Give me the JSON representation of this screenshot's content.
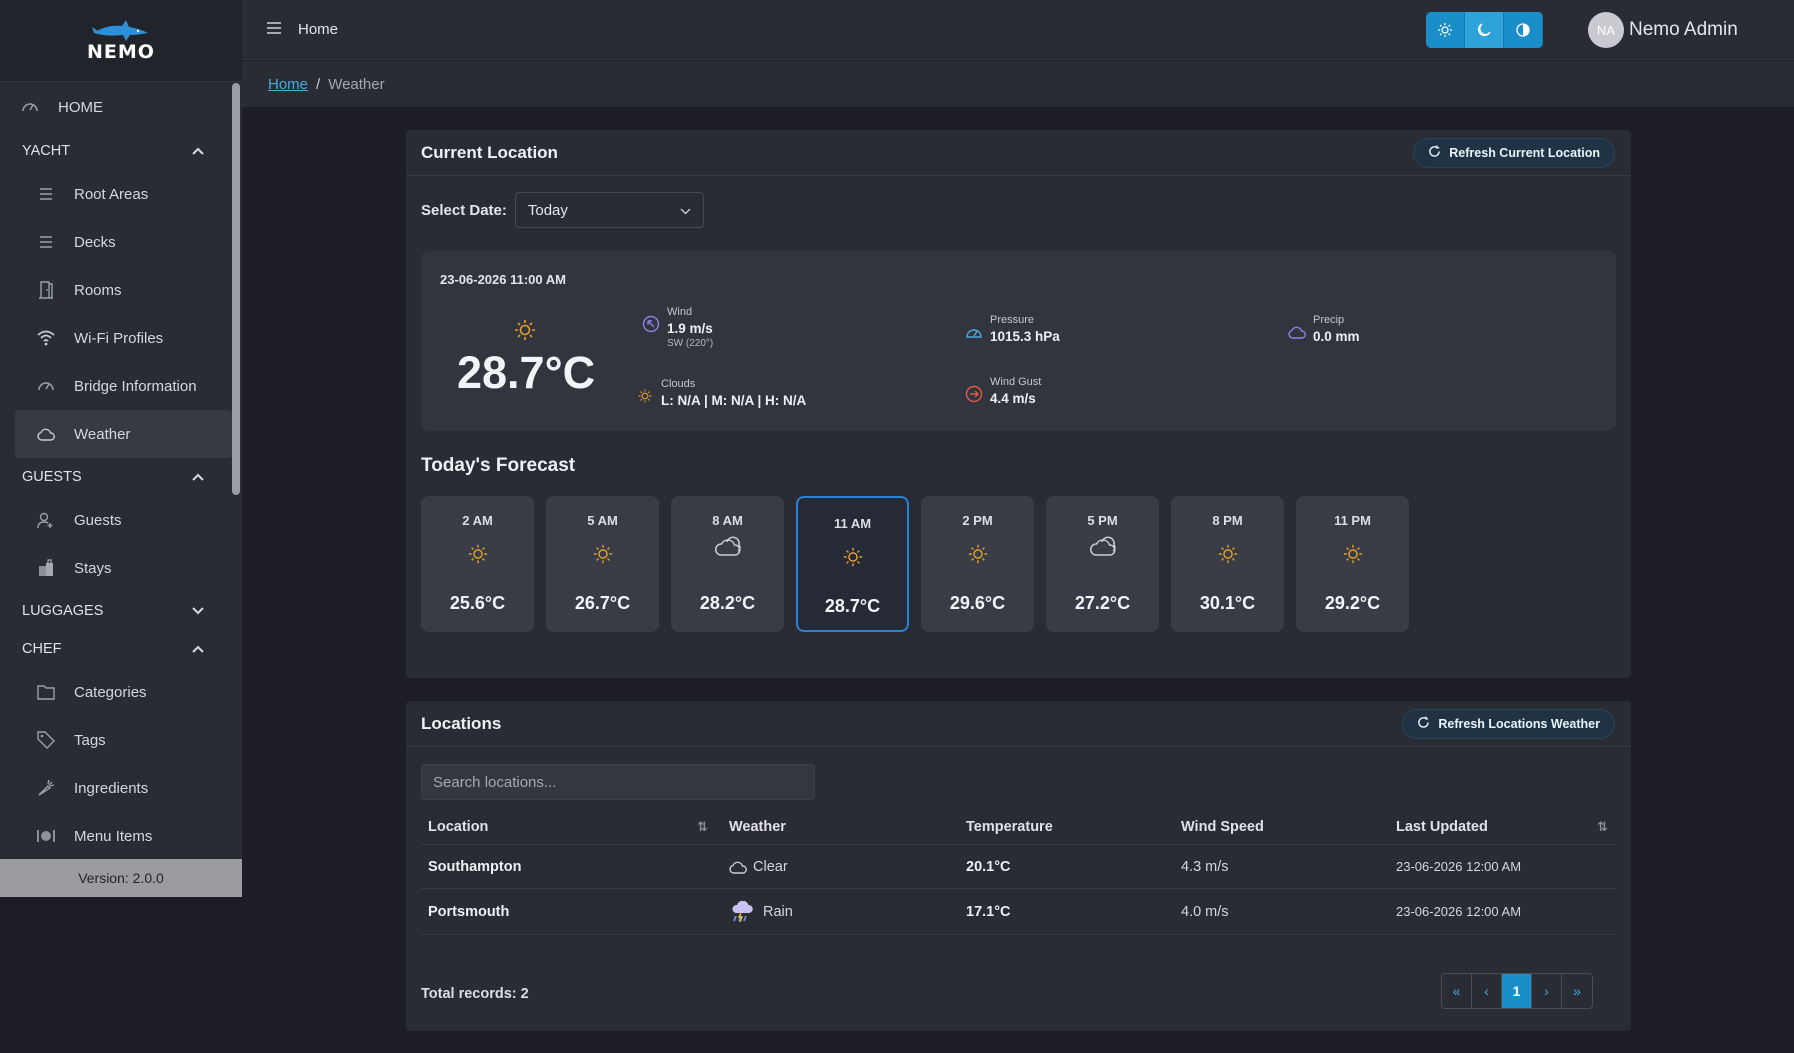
{
  "app": {
    "logo_text": "NEMO"
  },
  "topbar": {
    "page_title": "Home",
    "user_initials": "NA",
    "user_name": "Nemo Admin"
  },
  "breadcrumb": {
    "home": "Home",
    "separator": "/",
    "current": "Weather"
  },
  "sidebar": {
    "home": "HOME",
    "sections": {
      "yacht": "YACHT",
      "guests": "GUESTS",
      "luggages": "LUGGAGES",
      "chef": "CHEF"
    },
    "items": {
      "root_areas": "Root Areas",
      "decks": "Decks",
      "rooms": "Rooms",
      "wifi": "Wi-Fi Profiles",
      "bridge": "Bridge Information",
      "weather": "Weather",
      "guests": "Guests",
      "stays": "Stays",
      "categories": "Categories",
      "tags": "Tags",
      "ingredients": "Ingredients",
      "menu_items": "Menu Items"
    },
    "version": "Version: 2.0.0"
  },
  "current": {
    "title": "Current Location",
    "refresh_label": "Refresh Current Location",
    "date_label": "Select Date:",
    "date_value": "Today",
    "datetime": "23-06-2026 11:00 AM",
    "temperature": "28.7°C",
    "wind_label": "Wind",
    "wind_value": "1.9 m/s",
    "wind_dir": "SW (220°)",
    "pressure_label": "Pressure",
    "pressure_value": "1015.3 hPa",
    "precip_label": "Precip",
    "precip_value": "0.0 mm",
    "clouds_label": "Clouds",
    "clouds_value": "L: N/A | M: N/A | H: N/A",
    "gust_label": "Wind Gust",
    "gust_value": "4.4 m/s"
  },
  "forecast": {
    "title": "Today's Forecast",
    "items": [
      {
        "time": "2 AM",
        "icon": "sun-icon",
        "temp": "25.6°C"
      },
      {
        "time": "5 AM",
        "icon": "sun-icon",
        "temp": "26.7°C"
      },
      {
        "time": "8 AM",
        "icon": "cloud-icon",
        "temp": "28.2°C"
      },
      {
        "time": "11 AM",
        "icon": "sun-icon",
        "temp": "28.7°C"
      },
      {
        "time": "2 PM",
        "icon": "sun-icon",
        "temp": "29.6°C"
      },
      {
        "time": "5 PM",
        "icon": "cloud-icon",
        "temp": "27.2°C"
      },
      {
        "time": "8 PM",
        "icon": "sun-icon",
        "temp": "30.1°C"
      },
      {
        "time": "11 PM",
        "icon": "sun-icon",
        "temp": "29.2°C"
      }
    ]
  },
  "locations": {
    "title": "Locations",
    "refresh_label": "Refresh Locations Weather",
    "search_placeholder": "Search locations...",
    "columns": [
      "Location",
      "Weather",
      "Temperature",
      "Wind Speed",
      "Last Updated"
    ],
    "rows": [
      {
        "location": "Southampton",
        "weather_icon": "cloud-icon",
        "weather": "Clear",
        "temp": "20.1°C",
        "wind": "4.3 m/s",
        "updated": "23-06-2026 12:00 AM"
      },
      {
        "location": "Portsmouth",
        "weather_icon": "rain-icon",
        "weather": "Rain",
        "temp": "17.1°C",
        "wind": "4.0 m/s",
        "updated": "23-06-2026 12:00 AM"
      }
    ],
    "total": "Total records: 2",
    "pager": [
      "«",
      "‹",
      "1",
      "›",
      "»"
    ]
  },
  "colors": {
    "accent": "#1a8ec8",
    "sun": "#e0a030",
    "background": "#1c1d26",
    "panel": "#2a2c34"
  }
}
